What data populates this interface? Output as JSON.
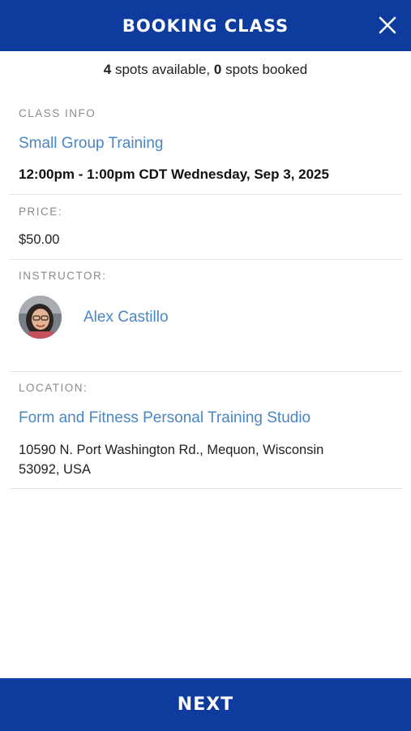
{
  "header": {
    "title": "BOOKING CLASS",
    "close_icon": "close-icon"
  },
  "availability": {
    "spots_available_count": "4",
    "spots_available_text": " spots available, ",
    "spots_booked_count": "0",
    "spots_booked_text": " spots booked"
  },
  "class_info": {
    "label": "CLASS INFO",
    "name": "Small Group Training",
    "datetime": "12:00pm - 1:00pm CDT Wednesday, Sep 3, 2025"
  },
  "price": {
    "label": "PRICE:",
    "value": "$50.00"
  },
  "instructor": {
    "label": "INSTRUCTOR:",
    "name": "Alex Castillo",
    "avatar": "instructor-avatar-photo"
  },
  "location": {
    "label": "LOCATION:",
    "name": "Form and Fitness Personal Training Studio",
    "address_line1": "10590 N. Port Washington Rd., Mequon, Wisconsin",
    "address_line2": "53092, USA"
  },
  "footer": {
    "next_label": "NEXT"
  },
  "colors": {
    "brand_blue": "#0d3b9e",
    "link_blue": "#4a86c5",
    "label_gray": "#8a8a8a",
    "divider": "#e3e3e3"
  }
}
